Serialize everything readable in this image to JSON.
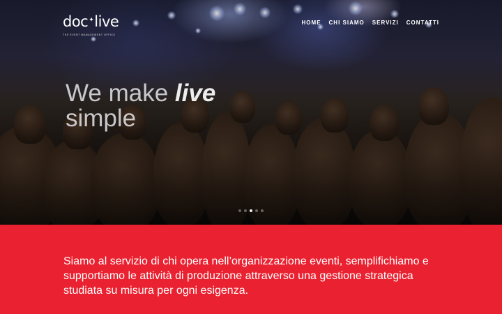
{
  "brand": {
    "logo_left": "doc",
    "logo_right": "live",
    "logo_star": "✦",
    "tagline": "The event management office"
  },
  "nav": {
    "items": [
      "HOME",
      "CHI SIAMO",
      "SERVIZI",
      "CONTATTI"
    ]
  },
  "hero": {
    "headline_part1": "We make ",
    "headline_em": "live",
    "headline_part2": "simple",
    "slide_count": 5,
    "active_slide": 3
  },
  "intro": {
    "text": "Siamo al servizio di chi opera nell’organizzazione eventi, semplifichiamo e supportiamo le attività di produzione attraverso una gestione strategica studiata su misura per ogni esigenza."
  },
  "colors": {
    "accent": "#ea2130",
    "text_light": "#ffffff"
  }
}
